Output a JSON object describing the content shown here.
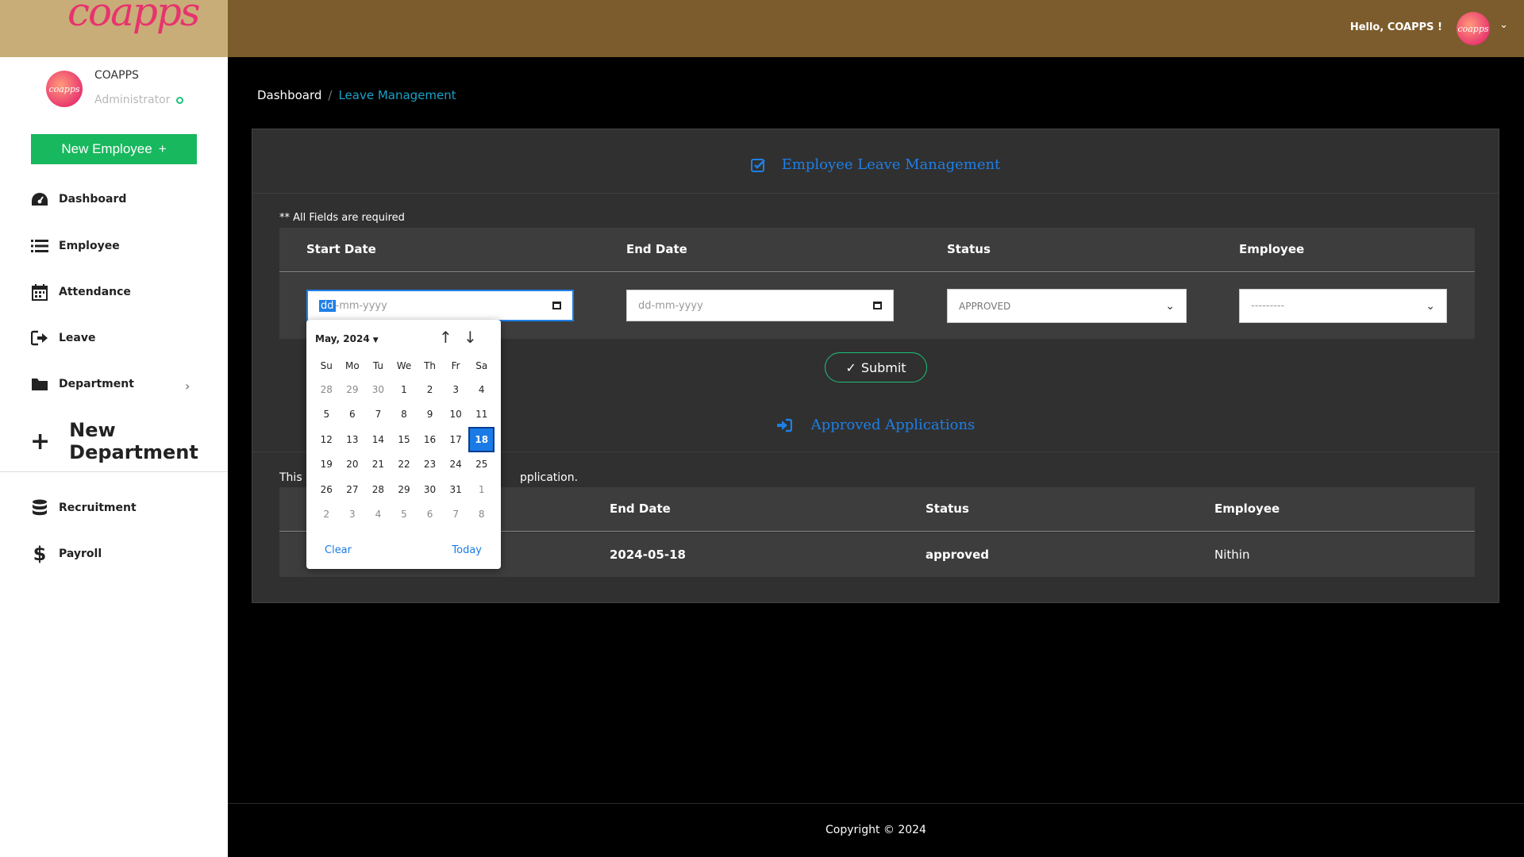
{
  "brand": {
    "logo_text": "coapps",
    "avatar_text": "coapps"
  },
  "topbar": {
    "greeting": "Hello, COAPPS !"
  },
  "sidebar": {
    "user_name": "COAPPS",
    "user_role": "Administrator",
    "new_employee_label": "New Employee",
    "items": [
      {
        "label": "Dashboard",
        "icon": "dashboard-icon"
      },
      {
        "label": "Employee",
        "icon": "list-icon"
      },
      {
        "label": "Attendance",
        "icon": "calendar-icon"
      },
      {
        "label": "Leave",
        "icon": "sign-out-icon"
      },
      {
        "label": "Department",
        "icon": "folder-icon"
      }
    ],
    "new_department_label": "New Department",
    "items2": [
      {
        "label": "Recruitment",
        "icon": "database-icon"
      },
      {
        "label": "Payroll",
        "icon": "dollar-icon"
      }
    ]
  },
  "breadcrumb": {
    "home": "Dashboard",
    "current": "Leave Management"
  },
  "form": {
    "title": "Employee Leave Management",
    "required_note": "** All Fields are required",
    "headers": {
      "start": "Start Date",
      "end": "End Date",
      "status": "Status",
      "employee": "Employee"
    },
    "start_highlight": "dd",
    "start_rest": "-mm-yyyy",
    "end_placeholder": "dd-mm-yyyy",
    "status_value": "APPROVED",
    "employee_value": "---------",
    "submit_label": "Submit"
  },
  "approved": {
    "title": "Approved Applications",
    "note_start": "This i",
    "note_end": "pplication.",
    "headers": {
      "end": "End Date",
      "status": "Status",
      "employee": "Employee"
    },
    "rows": [
      {
        "end": "2024-05-18",
        "status": "approved",
        "employee": "Nithin"
      }
    ]
  },
  "calendar": {
    "month_label": "May, 2024",
    "weekdays": [
      "Su",
      "Mo",
      "Tu",
      "We",
      "Th",
      "Fr",
      "Sa"
    ],
    "days": [
      "28",
      "29",
      "30",
      "1",
      "2",
      "3",
      "4",
      "5",
      "6",
      "7",
      "8",
      "9",
      "10",
      "11",
      "12",
      "13",
      "14",
      "15",
      "16",
      "17",
      "18",
      "19",
      "20",
      "21",
      "22",
      "23",
      "24",
      "25",
      "26",
      "27",
      "28",
      "29",
      "30",
      "31",
      "1",
      "2",
      "3",
      "4",
      "5",
      "6",
      "7",
      "8"
    ],
    "selected_day": "18",
    "clear_label": "Clear",
    "today_label": "Today"
  },
  "footer": {
    "copyright": "Copyright © 2024"
  },
  "colors": {
    "accent": "#1e7fe6",
    "success": "#18b85e",
    "topbar": "#7c5c2c",
    "brand_bg": "#c8ad78"
  }
}
